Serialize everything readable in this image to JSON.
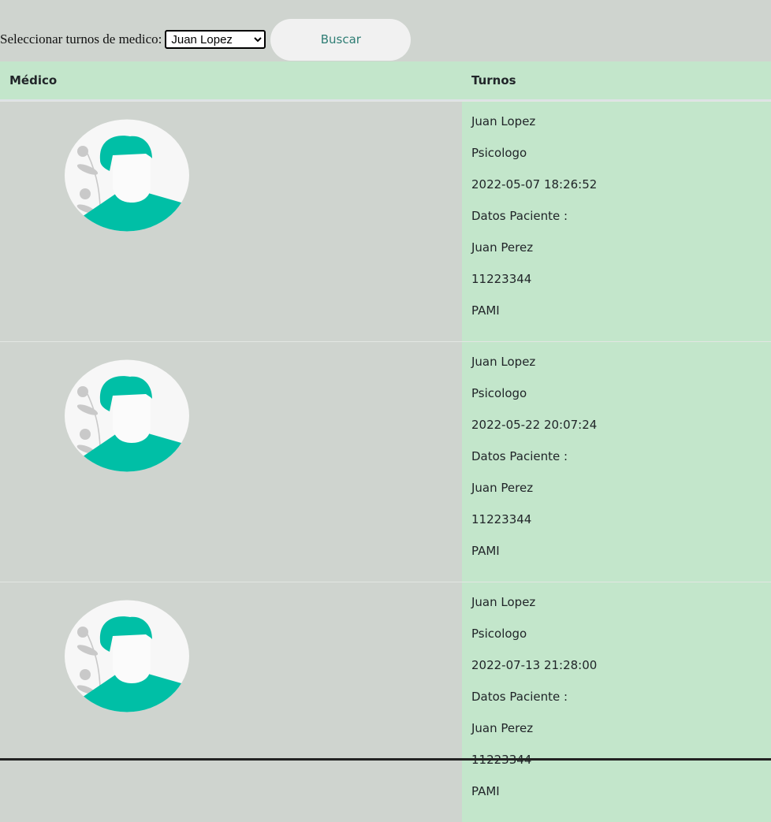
{
  "toolbar": {
    "label": "Seleccionar turnos de medico:",
    "selected_doctor": "Juan Lopez",
    "doctor_options": [
      "Juan Lopez"
    ],
    "search_label": "Buscar"
  },
  "table": {
    "headers": {
      "medico": "Médico",
      "turnos": "Turnos"
    },
    "rows": [
      {
        "doctor": "Juan Lopez",
        "specialty": "Psicologo",
        "datetime": "2022-05-07 18:26:52",
        "patient_header": "Datos Paciente :",
        "patient_name": "Juan Perez",
        "patient_id": "11223344",
        "insurance": "PAMI"
      },
      {
        "doctor": "Juan Lopez",
        "specialty": "Psicologo",
        "datetime": "2022-05-22 20:07:24",
        "patient_header": "Datos Paciente :",
        "patient_name": "Juan Perez",
        "patient_id": "11223344",
        "insurance": "PAMI"
      },
      {
        "doctor": "Juan Lopez",
        "specialty": "Psicologo",
        "datetime": "2022-07-13 21:28:00",
        "patient_header": "Datos Paciente :",
        "patient_name": "Juan Perez",
        "patient_id": "11223344",
        "insurance": "PAMI"
      }
    ]
  },
  "colors": {
    "page_bg": "#cfd4cf",
    "turnos_bg": "#c3e6cb",
    "avatar_accent": "#00bfa6"
  },
  "icons": {
    "avatar": "doctor-avatar-icon"
  }
}
